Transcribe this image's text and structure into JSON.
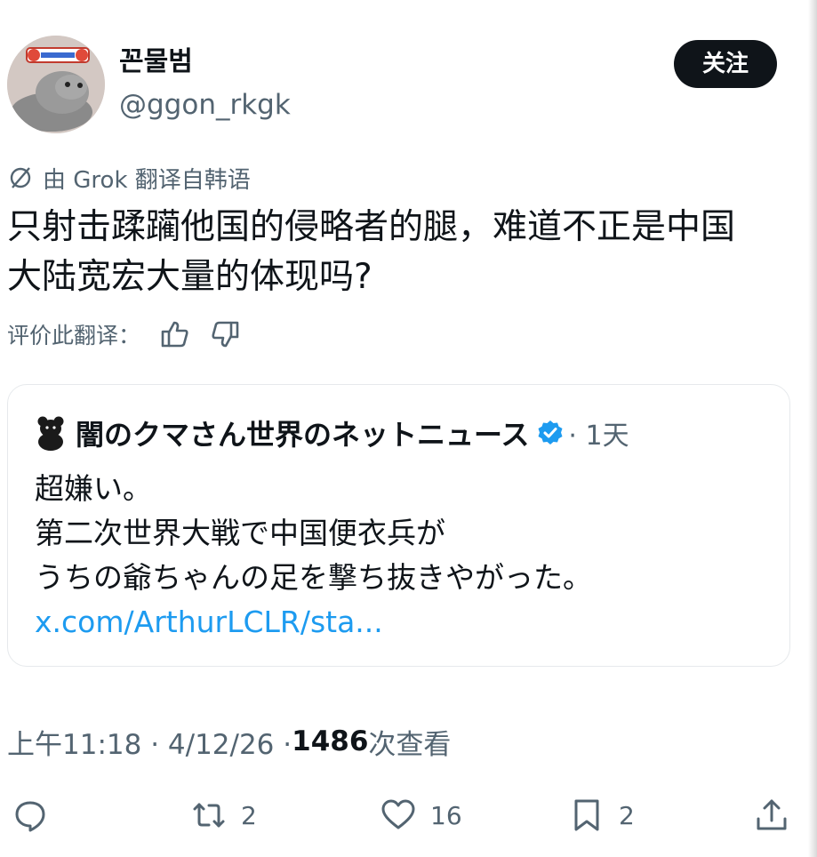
{
  "user": {
    "display_name": "꼰물범",
    "handle": "@ggon_rkgk",
    "follow_label": "关注"
  },
  "translation": {
    "note": "由 Grok 翻译自韩语",
    "text_lines": [
      "只射击蹂躏他国的侵略者的腿，难道不正是中国",
      "大陆宽宏大量的体现吗?"
    ],
    "rate_label": "评价此翻译："
  },
  "quote": {
    "name": "闇のクマさん世界のネットニュース",
    "time": "· 1天",
    "lines": [
      "超嫌い。",
      "第二次世界大戦で中国便衣兵が",
      "うちの爺ちゃんの足を撃ち抜きやがった。"
    ],
    "link": "x.com/ArthurLCLR/sta..."
  },
  "meta": {
    "time": "上午11:18 · 4/12/26 · ",
    "views": "1486",
    "views_label": " 次查看"
  },
  "actions": {
    "retweets": "2",
    "likes": "16",
    "bookmarks": "2"
  },
  "colors": {
    "text": "#0f1419",
    "secondary": "#536471",
    "link": "#1d9bf0",
    "verified": "#1d9bf0",
    "button_bg": "#0f1419"
  }
}
